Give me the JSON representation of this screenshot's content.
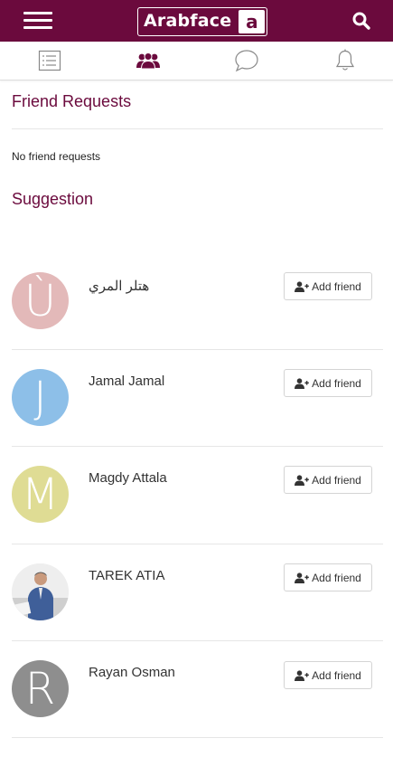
{
  "header": {
    "logo_text": "Arabface",
    "logo_mark": "a",
    "brand_color": "#6b0a3d"
  },
  "tabs": [
    {
      "name": "feed-tab",
      "icon": "list-icon"
    },
    {
      "name": "friends-tab",
      "icon": "users-icon",
      "active": true
    },
    {
      "name": "messages-tab",
      "icon": "chat-bubble-icon"
    },
    {
      "name": "notifications-tab",
      "icon": "bell-icon"
    }
  ],
  "friend_requests": {
    "title": "Friend Requests",
    "empty_text": "No friend requests"
  },
  "suggestion": {
    "title": "Suggestion",
    "add_label": "Add friend",
    "people": [
      {
        "name": "هتلر المري",
        "initial": "Ù",
        "color": "#e3b9b9"
      },
      {
        "name": "Jamal Jamal",
        "initial": "J",
        "color": "#8dbfe8"
      },
      {
        "name": "Magdy Attala",
        "initial": "M",
        "color": "#dfdc94"
      },
      {
        "name": "TAREK ATIA",
        "initial": "",
        "photo": true
      },
      {
        "name": "Rayan Osman",
        "initial": "R",
        "color": "#8e8e8e"
      }
    ]
  }
}
